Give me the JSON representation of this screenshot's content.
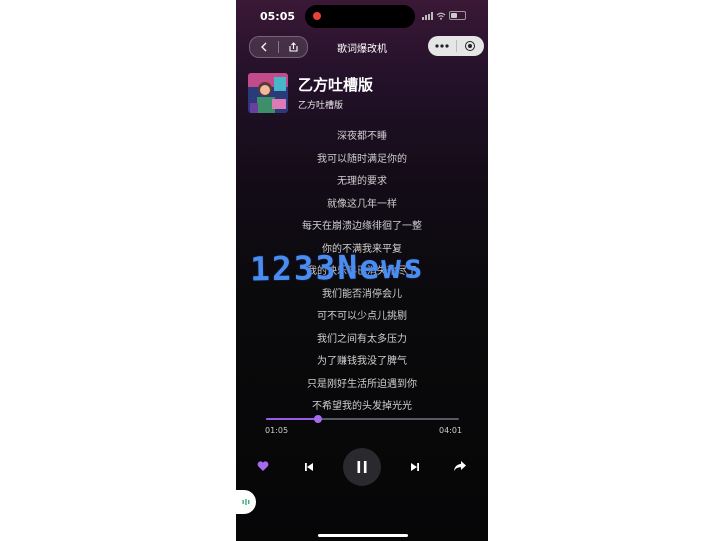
{
  "status_bar": {
    "time": "05:05",
    "icons": [
      "signal-icon",
      "wifi-icon",
      "battery-icon"
    ]
  },
  "nav": {
    "title": "歌词爆改机",
    "back_icon": "chevron-left-icon",
    "share_icon": "share-box-icon",
    "more_icon": "more-dots-icon",
    "close_icon": "target-circle-icon"
  },
  "song": {
    "title": "乙方吐槽版",
    "artist": "乙方吐槽版"
  },
  "lyrics": [
    "深夜都不睡",
    "我可以随时满足你的",
    "无理的要求",
    "就像这几年一样",
    "每天在崩溃边缘徘徊了一整",
    "你的不满我来平复",
    "我的快乐早已消失殆尽了",
    "我们能否消停会儿",
    "可不可以少点儿挑剔",
    "我们之间有太多压力",
    "为了赚钱我没了脾气",
    "只是刚好生活所迫遇到你",
    "不希望我的头发掉光光"
  ],
  "player": {
    "current_time": "01:05",
    "total_time": "04:01",
    "progress_fraction": 0.27,
    "accent_color": "#9a5ce6"
  },
  "controls": {
    "icons": [
      "heart-icon",
      "previous-track-icon",
      "pause-icon",
      "next-track-icon",
      "share-arrow-icon"
    ]
  },
  "watermark": {
    "text": "1233News",
    "color": "#4a8cf0"
  }
}
